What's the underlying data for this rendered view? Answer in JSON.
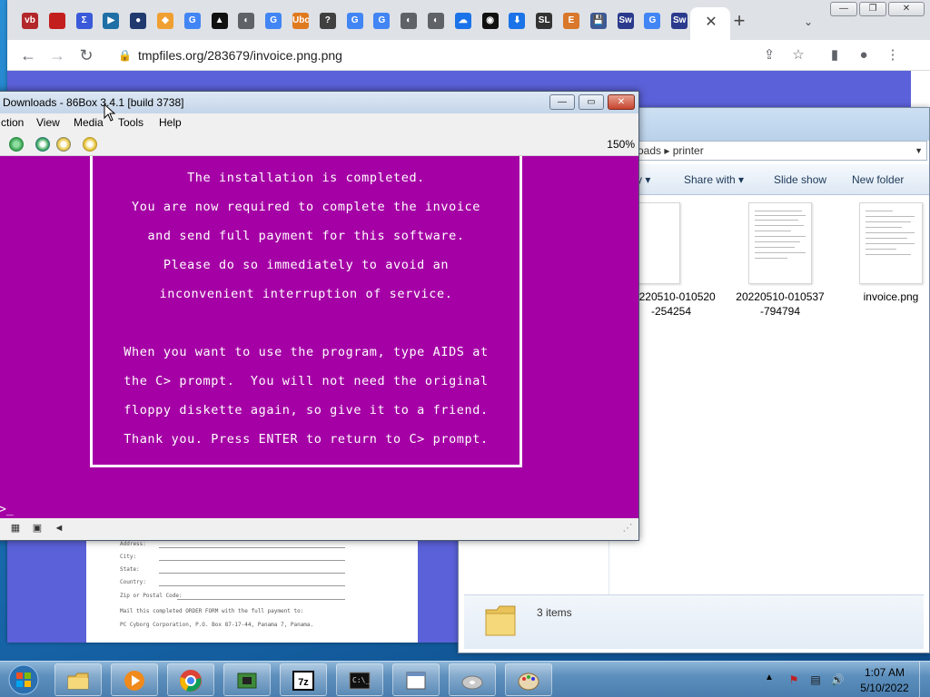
{
  "chrome": {
    "tab_favicons": [
      {
        "name": "vb-favicon",
        "label": "vb",
        "color": "#b3262a"
      },
      {
        "name": "red-square-favicon",
        "label": "",
        "color": "#c41f1f"
      },
      {
        "name": "sigma-favicon",
        "label": "Σ",
        "color": "#3a5ad9"
      },
      {
        "name": "play-box-favicon",
        "label": "▶",
        "color": "#1d6fa5"
      },
      {
        "name": "news-circle-favicon",
        "label": "●",
        "color": "#203a70"
      },
      {
        "name": "diamond-favicon",
        "label": "◆",
        "color": "#f0a030"
      },
      {
        "name": "google-favicon",
        "label": "G",
        "color": "#4285f4"
      },
      {
        "name": "triangle-favicon",
        "label": "▲",
        "color": "#111111"
      },
      {
        "name": "globe-favicon",
        "label": "◐",
        "color": "#5f6368"
      },
      {
        "name": "google-favicon",
        "label": "G",
        "color": "#4285f4"
      },
      {
        "name": "ubo-favicon",
        "label": "Ubo",
        "color": "#e07a1f"
      },
      {
        "name": "id-card-favicon",
        "label": "?",
        "color": "#404040"
      },
      {
        "name": "google-favicon",
        "label": "G",
        "color": "#4285f4"
      },
      {
        "name": "google-favicon",
        "label": "G",
        "color": "#4285f4"
      },
      {
        "name": "globe-favicon",
        "label": "◐",
        "color": "#5f6368"
      },
      {
        "name": "globe-favicon",
        "label": "◐",
        "color": "#5f6368"
      },
      {
        "name": "cloud-upload-favicon",
        "label": "☁",
        "color": "#1a73e8"
      },
      {
        "name": "github-favicon",
        "label": "◉",
        "color": "#111111"
      },
      {
        "name": "download-favicon",
        "label": "⬇",
        "color": "#1a73e8"
      },
      {
        "name": "sl-favicon",
        "label": "SL",
        "color": "#333333"
      },
      {
        "name": "e-favicon",
        "label": "E",
        "color": "#d9772a"
      },
      {
        "name": "floppy-favicon",
        "label": "💾",
        "color": "#3c5a96"
      },
      {
        "name": "sw-favicon",
        "label": "Sw",
        "color": "#2a3a8c"
      },
      {
        "name": "google-favicon",
        "label": "G",
        "color": "#4285f4"
      },
      {
        "name": "sw-favicon",
        "label": "Sw",
        "color": "#2a3a8c"
      }
    ],
    "tab_close_glyph": "✕",
    "new_tab_glyph": "+",
    "tab_search_glyph": "⌄",
    "caption": {
      "minimize": "—",
      "maximize": "❐",
      "close": "✕"
    },
    "toolbar": {
      "back": "←",
      "forward": "→",
      "reload": "↻",
      "lock": "🔒",
      "url": "tmpfiles.org/283679/invoice.png.png",
      "share": "⇪",
      "bookmark": "☆",
      "side_panel": "▮",
      "profile": "●",
      "menu": "⋮"
    },
    "invoice_lines": [
      "Address:",
      "City:",
      "State:",
      "Country:",
      "Zip or Postal Code:",
      "Mail this completed ORDER FORM with the full payment to:",
      "PC Cyborg Corporation, P.O. Box 87-17-44, Panama 7, Panama."
    ]
  },
  "explorer": {
    "address": "oads ▸ printer",
    "commands": [
      "y ▾",
      "Share with ▾",
      "Slide show",
      "New folder"
    ],
    "files": [
      {
        "name_line1": "20220510-010520",
        "name_line2": "-254254"
      },
      {
        "name_line1": "20220510-010537",
        "name_line2": "-794794"
      },
      {
        "name_line1": "invoice.png",
        "name_line2": ""
      }
    ],
    "items_count": "3 items"
  },
  "box86": {
    "title": "Downloads - 86Box 3.4.1 [build 3738]",
    "buttons": {
      "minimize": "—",
      "maximize": "▭",
      "close": "✕"
    },
    "menu": [
      "ction",
      "View",
      "Media",
      "Tools",
      "Help"
    ],
    "zoom": "150%",
    "screen_lines": [
      "The installation is completed.",
      "You are now required to complete the invoice",
      "and send full payment for this software.",
      "Please do so immediately to avoid an",
      "inconvenient interruption of service.",
      "",
      "When you want to use the program, type AIDS at",
      "the C> prompt.  You will not need the original",
      "floppy diskette again, so give it to a friend.",
      "Thank you. Press ENTER to return to C> prompt."
    ],
    "prompt": ">_",
    "colors": {
      "screen": "#a500a5",
      "text": "#ffffff"
    }
  },
  "taskbar": {
    "clock_time": "1:07 AM",
    "clock_date": "5/10/2022",
    "tray_up": "▲",
    "tray_icons": [
      "⚑",
      "▤",
      "🔊"
    ]
  }
}
